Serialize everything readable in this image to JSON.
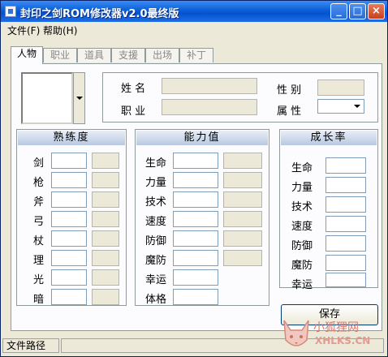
{
  "window": {
    "title": "封印之剑ROM修改器v2.0最终版",
    "minimize": "_",
    "restore": "□",
    "close": "×"
  },
  "menu": {
    "file": "文件(F)",
    "help": "帮助(H)"
  },
  "tabs": [
    "人物",
    "职业",
    "道具",
    "支援",
    "出场",
    "补丁"
  ],
  "info": {
    "name_label": "姓  名",
    "class_label": "职  业",
    "gender_label": "性  别",
    "attribute_label": "属  性"
  },
  "proficiency": {
    "title": "熟练度",
    "labels": [
      "剑",
      "枪",
      "斧",
      "弓",
      "杖",
      "理",
      "光",
      "暗"
    ]
  },
  "abilities": {
    "title": "能力值",
    "labels": [
      "生命",
      "力量",
      "技术",
      "速度",
      "防御",
      "魔防",
      "幸运",
      "体格"
    ]
  },
  "growth": {
    "title": "成长率",
    "labels": [
      "生命",
      "力量",
      "技术",
      "速度",
      "防御",
      "魔防",
      "幸运"
    ]
  },
  "save_label": "保存",
  "status": {
    "file_path_label": "文件路径"
  },
  "watermark": {
    "text": "小狐狸网",
    "url": "XHLKS.CN"
  }
}
